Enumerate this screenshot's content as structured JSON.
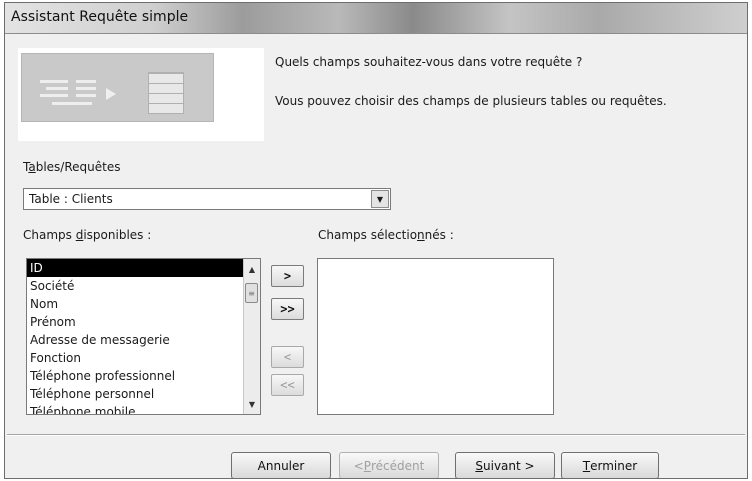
{
  "window": {
    "title": "Assistant Requête simple"
  },
  "intro": {
    "question": "Quels champs souhaitez-vous dans votre requête ?",
    "hint": "Vous pouvez choisir des champs de plusieurs tables ou requêtes."
  },
  "tables": {
    "label_pre": "T",
    "label_key": "a",
    "label_post": "bles/Requêtes",
    "selected": "Table : Clients"
  },
  "available": {
    "label_pre": "Champs ",
    "label_key": "d",
    "label_post": "isponibles :",
    "items": [
      "ID",
      "Société",
      "Nom",
      "Prénom",
      "Adresse de messagerie",
      "Fonction",
      "Téléphone professionnel",
      "Téléphone personnel",
      "Téléphone mobile"
    ],
    "selected_index": 0
  },
  "selected_fields": {
    "label_pre": "Champs sélectio",
    "label_key": "n",
    "label_post": "nés :",
    "items": []
  },
  "move_buttons": {
    "add_one": ">",
    "add_all": ">>",
    "remove_one": "<",
    "remove_all": "<<"
  },
  "buttons": {
    "cancel": "Annuler",
    "previous_prefix": "< ",
    "previous_key": "P",
    "previous_rest": "récédent",
    "next_key": "S",
    "next_rest": "uivant >",
    "finish_key": "T",
    "finish_rest": "erminer"
  }
}
